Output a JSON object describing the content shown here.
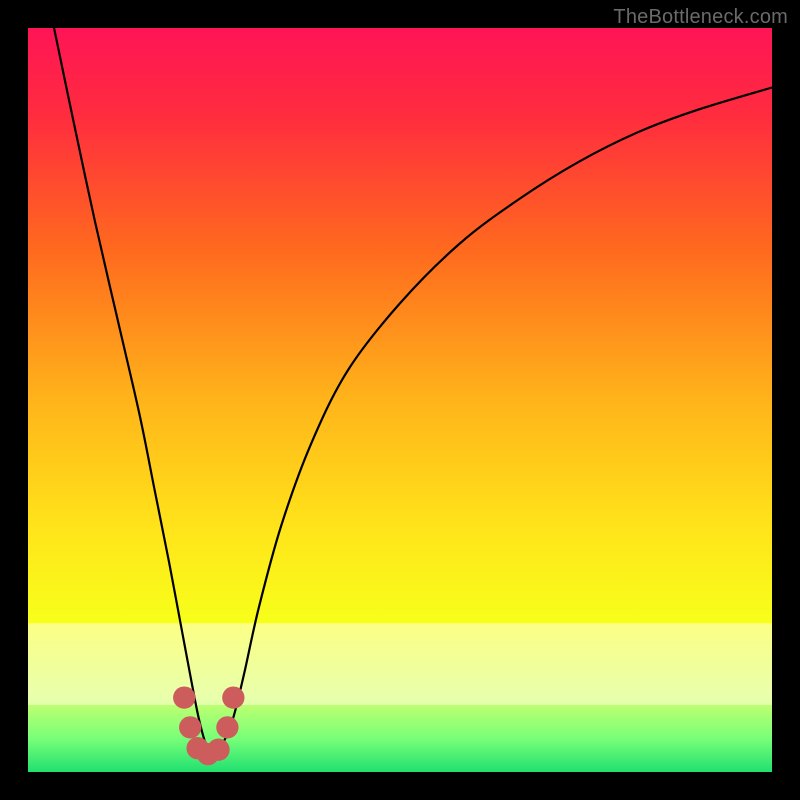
{
  "watermark": "TheBottleneck.com",
  "chart_data": {
    "type": "line",
    "title": "",
    "xlabel": "",
    "ylabel": "",
    "xlim": [
      0,
      100
    ],
    "ylim": [
      0,
      100
    ],
    "grid": false,
    "legend": false,
    "gradient_stops": [
      {
        "offset": 0.0,
        "color": "#ff1456"
      },
      {
        "offset": 0.12,
        "color": "#ff2d3e"
      },
      {
        "offset": 0.3,
        "color": "#ff6a1e"
      },
      {
        "offset": 0.5,
        "color": "#ffb41a"
      },
      {
        "offset": 0.68,
        "color": "#ffe61a"
      },
      {
        "offset": 0.8,
        "color": "#f7ff1a"
      },
      {
        "offset": 0.9,
        "color": "#ccff70"
      },
      {
        "offset": 0.955,
        "color": "#78ff78"
      },
      {
        "offset": 1.0,
        "color": "#20e070"
      }
    ],
    "series": [
      {
        "name": "bottleneck-curve",
        "x": [
          3.5,
          6,
          9,
          12,
          15,
          17,
          19,
          20.5,
          22,
          23,
          24,
          25,
          26,
          27.5,
          29,
          31,
          34,
          38,
          43,
          50,
          58,
          66,
          74,
          82,
          90,
          100
        ],
        "y": [
          100,
          88,
          74,
          61,
          48,
          38,
          28,
          20,
          12,
          7,
          3.5,
          2.5,
          3.5,
          7,
          13,
          22,
          33,
          44,
          54,
          63,
          71,
          77,
          82,
          86,
          89,
          92
        ]
      }
    ],
    "markers": {
      "name": "highlight-points",
      "color": "#cd5c5c",
      "radius_pct": 1.5,
      "points": [
        {
          "x": 21.0,
          "y": 10.0
        },
        {
          "x": 21.8,
          "y": 6.0
        },
        {
          "x": 22.8,
          "y": 3.2
        },
        {
          "x": 24.2,
          "y": 2.4
        },
        {
          "x": 25.6,
          "y": 3.0
        },
        {
          "x": 26.8,
          "y": 6.0
        },
        {
          "x": 27.6,
          "y": 10.0
        }
      ]
    }
  }
}
